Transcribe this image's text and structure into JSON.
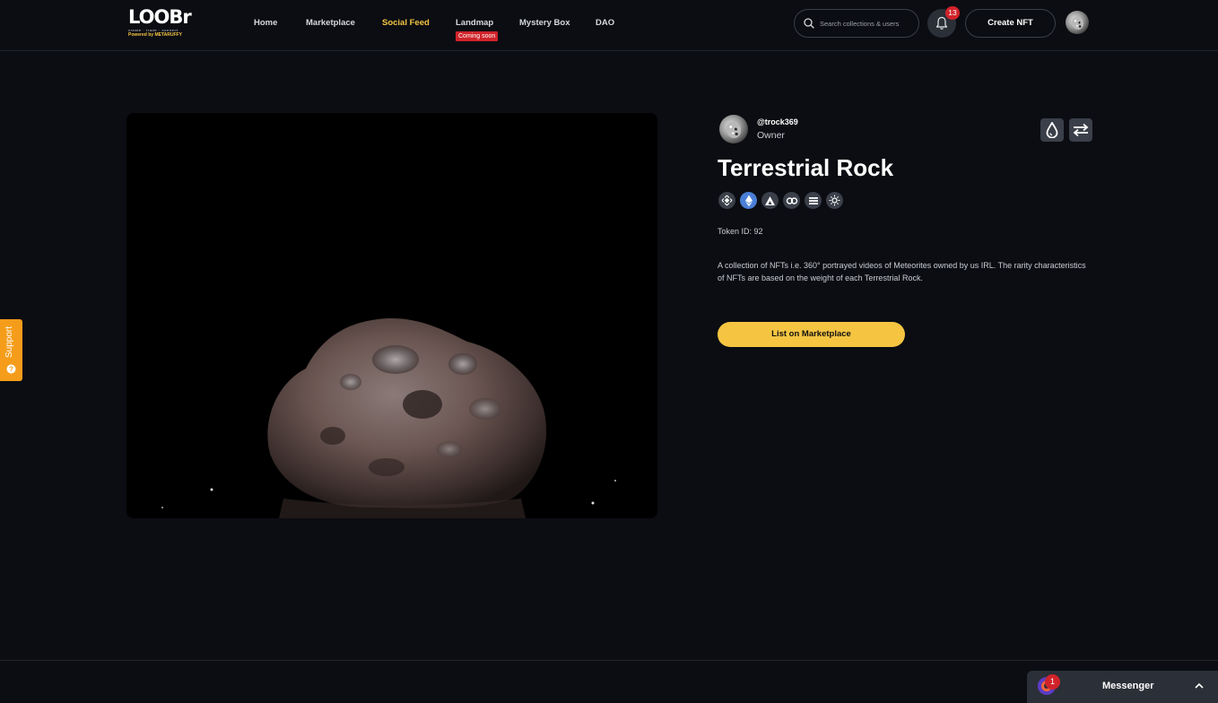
{
  "header": {
    "logo": {
      "word": "LOOBr",
      "tagline": "create · trade · connect",
      "powered_by": "Powered by METARUFFY"
    },
    "nav": [
      {
        "label": "Home"
      },
      {
        "label": "Marketplace"
      },
      {
        "label": "Social Feed",
        "active": true
      },
      {
        "label": "Landmap",
        "badge": "Coming soon"
      },
      {
        "label": "Mystery Box"
      },
      {
        "label": "DAO"
      }
    ],
    "search": {
      "placeholder": "Search collections & users"
    },
    "notifications": {
      "count": "13",
      "icon": "bell-icon"
    },
    "create_button": "Create NFT",
    "user_avatar": "rock-avatar"
  },
  "nft": {
    "owner": {
      "handle": "@trock369",
      "role": "Owner"
    },
    "actions": [
      {
        "icon": "drop-icon"
      },
      {
        "icon": "transfer-icon"
      }
    ],
    "title": "Terrestrial Rock",
    "chains": [
      {
        "icon": "bnb-icon"
      },
      {
        "icon": "ethereum-icon"
      },
      {
        "icon": "avalanche-icon"
      },
      {
        "icon": "link-icon"
      },
      {
        "icon": "solana-icon"
      },
      {
        "icon": "sun-icon"
      }
    ],
    "token_id": "Token ID: 92",
    "description": "A collection of NFTs i.e. 360° portrayed videos of Meteorites owned by us IRL. The rarity characteristics of NFTs are based on the weight of each Terrestrial Rock.",
    "list_button": "List on Marketplace"
  },
  "support": {
    "label": "Support"
  },
  "messenger": {
    "label": "Messenger",
    "count": "1"
  },
  "colors": {
    "background": "#0b0d12",
    "accent": "#f5c542",
    "alert": "#d0232a",
    "support": "#f59d1b"
  }
}
